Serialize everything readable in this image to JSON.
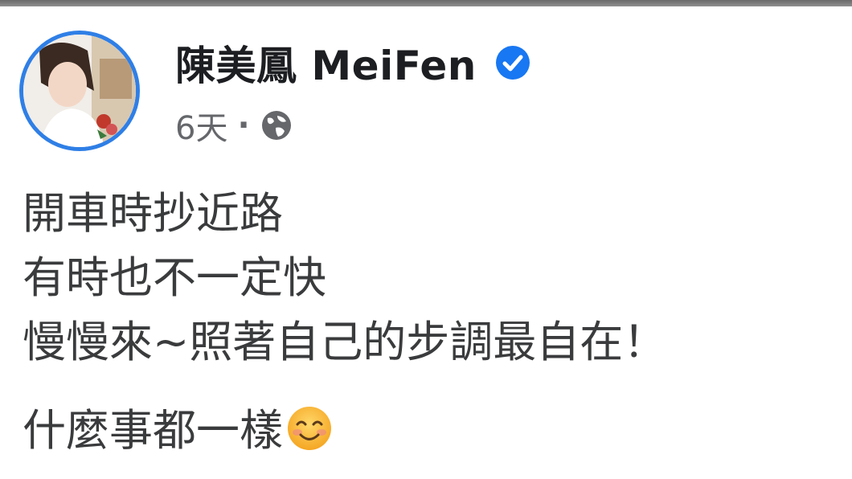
{
  "post": {
    "author": "陳美鳳 MeiFen",
    "timestamp": "6天",
    "separator": "·",
    "audience_icon": "globe-icon",
    "verified_icon": "verified-badge-icon",
    "lines": [
      "開車時抄近路",
      "有時也不一定快",
      "慢慢來~照著自己的步調最自在！"
    ],
    "last_line": "什麼事都一樣",
    "emoji": "smiling-face-emoji"
  },
  "colors": {
    "verified": "#1877f2",
    "avatar_ring": "#2f7fe6",
    "meta_text": "#65676b",
    "body_text": "#3a3b3c"
  }
}
